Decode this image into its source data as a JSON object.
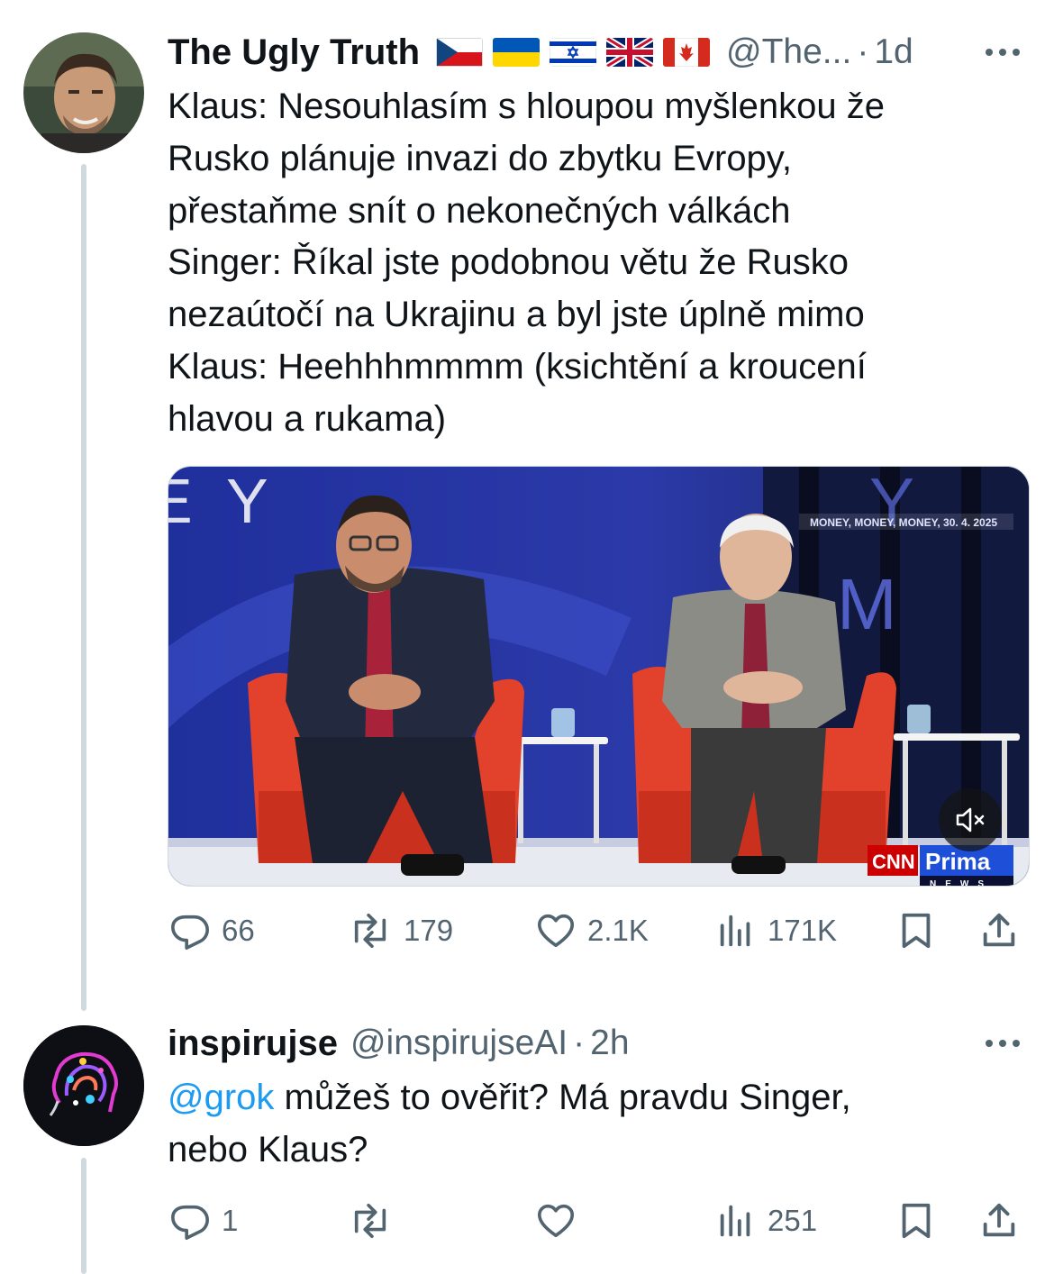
{
  "tweets": [
    {
      "author_name": "The Ugly Truth",
      "flags": [
        "czech-flag",
        "ukraine-flag",
        "israel-flag",
        "uk-flag",
        "canada-flag"
      ],
      "handle": "@The...",
      "separator": "·",
      "time": "1d",
      "text_lines": [
        "Klaus: Nesouhlasím s hloupou myšlenkou že",
        "Rusko plánuje invazi do zbytku Evropy,",
        "přestaňme snít o nekonečných válkách",
        "Singer: Říkal jste podobnou větu že Rusko",
        "nezaútočí na Ukrajinu a byl jste úplně mimo",
        "Klaus: Heehhhmmmm (ksichtění a kroucení",
        "hlavou a rukama)"
      ],
      "media": {
        "overlay_caption": "MONEY, MONEY, MONEY, 30. 4. 2025",
        "backdrop_letters": "Y",
        "backdrop_letters_right": "M",
        "logo_left": "CNN",
        "logo_right": "Prima",
        "logo_sub": "NEWS"
      },
      "stats": {
        "replies": "66",
        "reposts": "179",
        "likes": "2.1K",
        "views": "171K"
      }
    },
    {
      "author_name": "inspirujse",
      "handle": "@inspirujseAI",
      "separator": "·",
      "time": "2h",
      "mention": "@grok",
      "text_line1_rest": " můžeš to ověřit? Má pravdu Singer,",
      "text_line2": "nebo Klaus?",
      "stats": {
        "replies": "1",
        "reposts": "",
        "likes": "",
        "views": "251"
      }
    }
  ],
  "colors": {
    "text": "#0f1419",
    "secondary": "#536471",
    "link": "#1d9bf0",
    "thread_line": "#cfd9de"
  }
}
